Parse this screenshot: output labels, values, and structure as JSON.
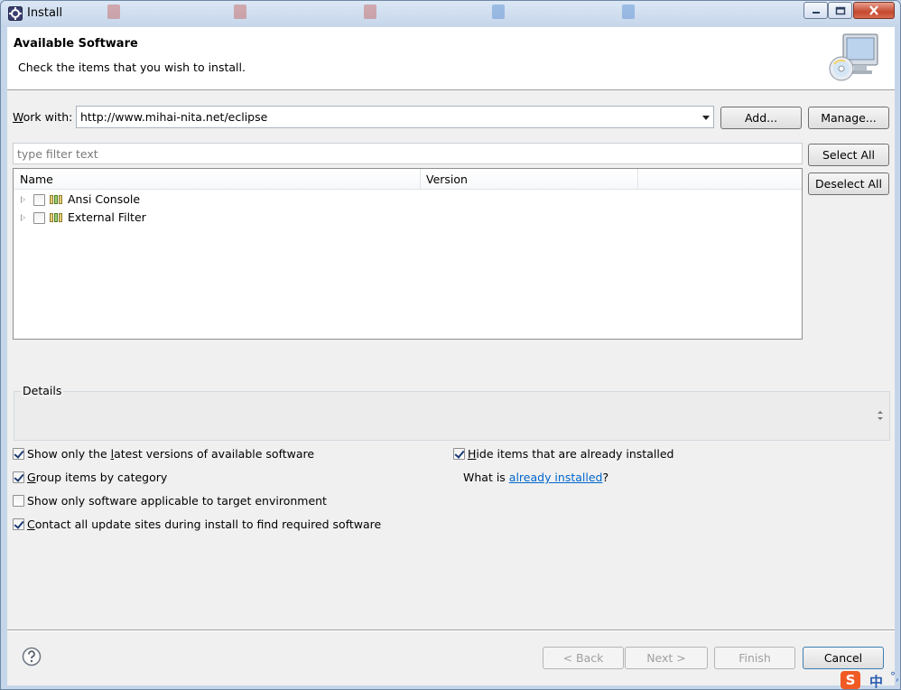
{
  "window": {
    "title": "Install"
  },
  "banner": {
    "title": "Available Software",
    "description": "Check the items that you wish to install."
  },
  "work_with": {
    "label": "Work with:",
    "mnemonic": "W",
    "label_rest": "ork with:",
    "value": "http://www.mihai-nita.net/eclipse"
  },
  "buttons": {
    "add": "Add...",
    "manage": "Manage...",
    "select_all": "Select All",
    "deselect_all": "Deselect All",
    "back": "< Back",
    "next": "Next >",
    "finish": "Finish",
    "cancel": "Cancel"
  },
  "filter": {
    "placeholder": "type filter text"
  },
  "table": {
    "columns": [
      "Name",
      "Version"
    ],
    "rows": [
      {
        "name": "Ansi Console",
        "version": "",
        "checked": false
      },
      {
        "name": "External Filter",
        "version": "",
        "checked": false
      }
    ]
  },
  "details": {
    "label": "Details"
  },
  "options": {
    "latest_versions": {
      "pre": "Show only the ",
      "mn": "l",
      "post": "atest versions of available software",
      "checked": true
    },
    "group_by_category": {
      "pre": "",
      "mn": "G",
      "post": "roup items by category",
      "checked": true
    },
    "target_env": {
      "pre": "Show only software applicable to target environment",
      "mn": "",
      "post": "",
      "checked": false
    },
    "contact_sites": {
      "pre": "",
      "mn": "C",
      "post": "ontact all update sites during install to find required software",
      "checked": true
    },
    "hide_installed": {
      "pre": "",
      "mn": "H",
      "post": "ide items that are already installed",
      "checked": true
    }
  },
  "already_installed": {
    "prefix": "What is ",
    "link": "already installed",
    "suffix": "?"
  },
  "ime": {
    "logo": "S",
    "lang": "中",
    "punct": "°,"
  },
  "icons": {
    "window": "eclipse-install-icon",
    "banner": "monitor-cd-icon",
    "help": "help-icon"
  },
  "colors": {
    "link": "#0066cc",
    "close_button": "#c5492f"
  }
}
